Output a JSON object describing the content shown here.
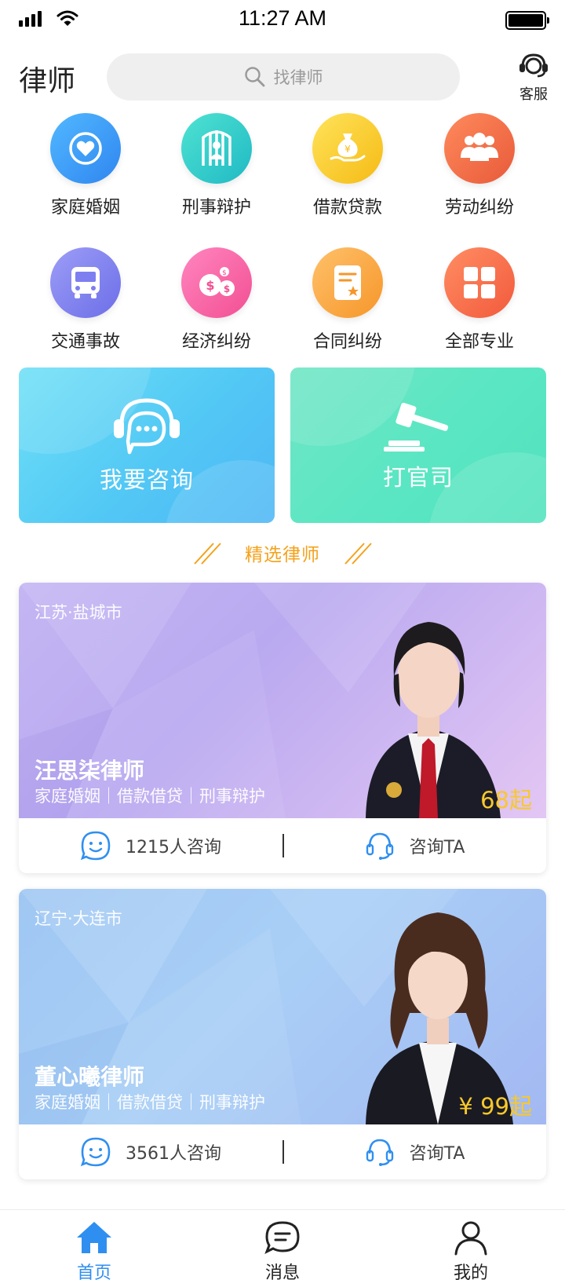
{
  "status_bar": {
    "time": "11:27 AM"
  },
  "header": {
    "title": "律师",
    "search_placeholder": "找律师",
    "service_label": "客服"
  },
  "categories": [
    {
      "label": "家庭婚姻",
      "icon": "heart-icon",
      "color_from": "#52b8ff",
      "color_to": "#2f86f0"
    },
    {
      "label": "刑事辩护",
      "icon": "prison-bars-icon",
      "color_from": "#4fe3d2",
      "color_to": "#1fb9c4"
    },
    {
      "label": "借款贷款",
      "icon": "money-bag-icon",
      "color_from": "#ffe35a",
      "color_to": "#f5bb15"
    },
    {
      "label": "劳动纠纷",
      "icon": "people-icon",
      "color_from": "#ff8a5c",
      "color_to": "#e85a3a"
    },
    {
      "label": "交通事故",
      "icon": "bus-icon",
      "color_from": "#9d9df7",
      "color_to": "#6c6ee8"
    },
    {
      "label": "经济纠纷",
      "icon": "coins-icon",
      "color_from": "#ff86bf",
      "color_to": "#f24f93"
    },
    {
      "label": "合同纠纷",
      "icon": "contract-icon",
      "color_from": "#ffc16a",
      "color_to": "#f6962a"
    },
    {
      "label": "全部专业",
      "icon": "grid-icon",
      "color_from": "#ff8d63",
      "color_to": "#f25a3c"
    }
  ],
  "banners": {
    "consult": "我要咨询",
    "lawsuit": "打官司"
  },
  "section": {
    "title": "精选律师"
  },
  "lawyers": [
    {
      "location": "江苏·盐城市",
      "name": "汪思柒律师",
      "tags": "家庭婚姻｜借款借贷｜刑事辩护",
      "price": "68起",
      "consult_count": "1215人咨询",
      "consult_button": "咨询TA"
    },
    {
      "location": "辽宁·大连市",
      "name": "董心曦律师",
      "tags": "家庭婚姻｜借款借贷｜刑事辩护",
      "price": "¥ 99起",
      "consult_count": "3561人咨询",
      "consult_button": "咨询TA"
    }
  ],
  "tabs": [
    {
      "label": "首页",
      "icon": "home-icon",
      "active": true
    },
    {
      "label": "消息",
      "icon": "message-icon",
      "active": false
    },
    {
      "label": "我的",
      "icon": "user-icon",
      "active": false
    }
  ],
  "colors": {
    "accent": "#2f8ff0",
    "highlight": "#f4a21b",
    "price": "#f7c92b"
  }
}
